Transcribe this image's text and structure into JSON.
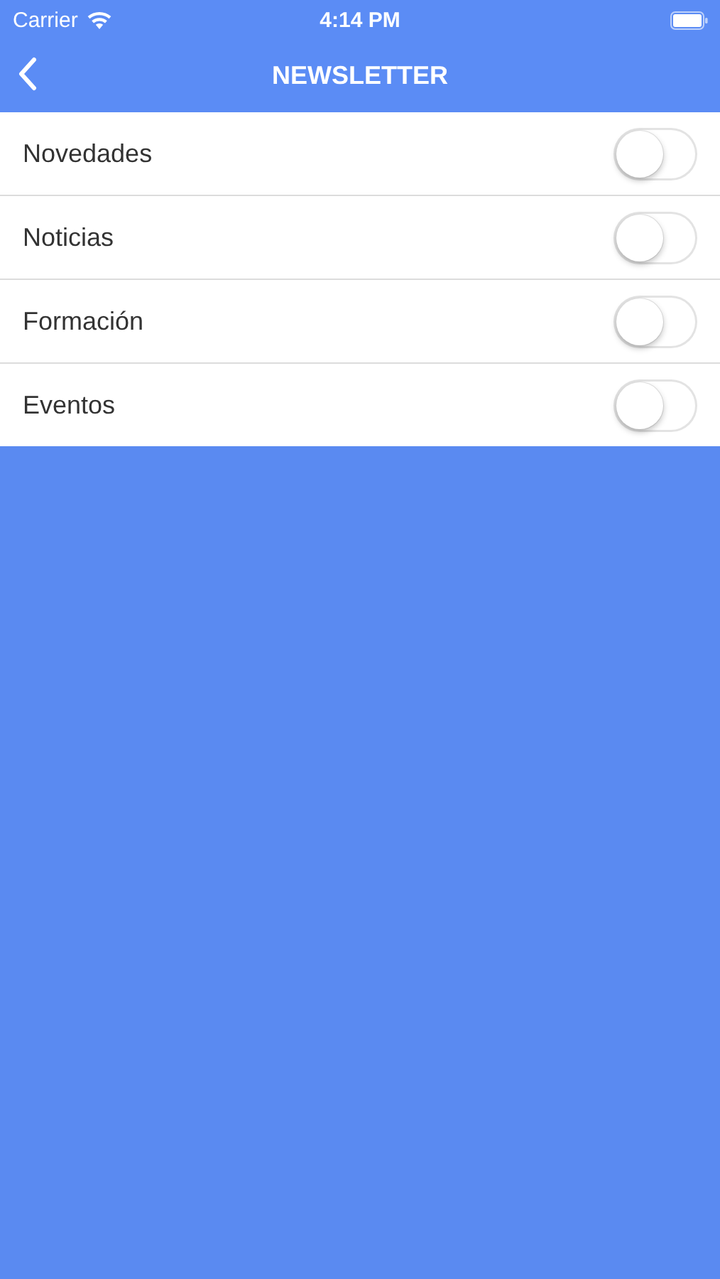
{
  "status_bar": {
    "carrier": "Carrier",
    "time": "4:14 PM"
  },
  "nav_bar": {
    "title": "NEWSLETTER"
  },
  "settings": [
    {
      "label": "Novedades",
      "on": false
    },
    {
      "label": "Noticias",
      "on": false
    },
    {
      "label": "Formación",
      "on": false
    },
    {
      "label": "Eventos",
      "on": false
    }
  ]
}
